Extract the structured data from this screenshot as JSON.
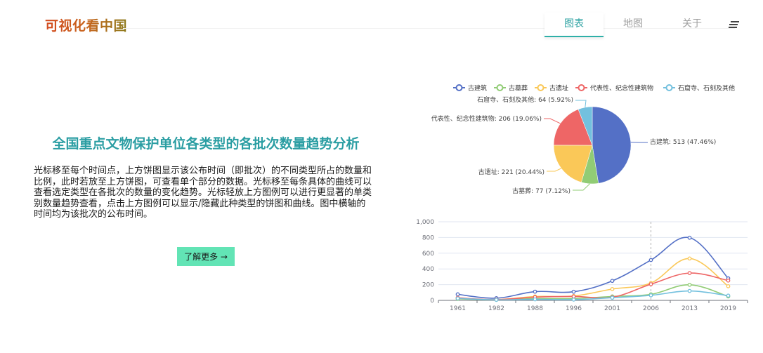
{
  "header": {
    "logo": "可视化看中国",
    "nav": [
      "图表",
      "地图",
      "关于"
    ]
  },
  "intro": {
    "title": "全国重点文物保护单位各类型的各批次数量趋势分析",
    "description": "光标移至每个时间点，上方饼图显示该公布时间（即批次）的不同类型所占的数量和比例，此时若放至上方饼图，可查看单个部分的数据。光标移至每条具体的曲线可以查看选定类型在各批次的数量的变化趋势。光标轻放上方图例可以进行更显著的单类别数量趋势查看，点击上方图例可以显示/隐藏此种类型的饼图和曲线。图中横轴的时间均为该批次的公布时间。",
    "button": "了解更多 →"
  },
  "chart_data": [
    {
      "type": "pie",
      "legend": [
        "古建筑",
        "古墓葬",
        "古遗址",
        "代表性、纪念性建筑物",
        "石窟寺、石刻及其他"
      ],
      "legend_position": "top",
      "slices": [
        {
          "name": "古建筑",
          "value": 513,
          "percent": "47.46%",
          "color": "#5470c6",
          "label": "古建筑: 513 (47.46%)"
        },
        {
          "name": "古墓葬",
          "value": 77,
          "percent": "7.12%",
          "color": "#91cc75",
          "label": "古墓葬: 77 (7.12%)"
        },
        {
          "name": "古遗址",
          "value": 221,
          "percent": "20.44%",
          "color": "#fac858",
          "label": "古遗址: 221 (20.44%)"
        },
        {
          "name": "代表性、纪念性建筑物",
          "value": 206,
          "percent": "19.06%",
          "color": "#ee6666",
          "label": "代表性、纪念性建筑物: 206 (19.06%)"
        },
        {
          "name": "石窟寺、石刻及其他",
          "value": 64,
          "percent": "5.92%",
          "color": "#73c0de",
          "label": "石窟寺、石刻及其他: 64 (5.92%)"
        }
      ]
    },
    {
      "type": "line",
      "x": [
        "1961",
        "1982",
        "1988",
        "1996",
        "2001",
        "2006",
        "2013",
        "2019"
      ],
      "y_ticks": [
        "0",
        "200",
        "400",
        "600",
        "800",
        "1,000"
      ],
      "ylim": [
        0,
        1000
      ],
      "grid": true,
      "highlight_x": "2006",
      "series": [
        {
          "name": "古建筑",
          "color": "#5470c6",
          "values": [
            77,
            28,
            111,
            110,
            248,
            513,
            797,
            280
          ]
        },
        {
          "name": "古墓葬",
          "color": "#91cc75",
          "values": [
            19,
            7,
            22,
            24,
            50,
            77,
            198,
            50
          ]
        },
        {
          "name": "古遗址",
          "color": "#fac858",
          "values": [
            26,
            10,
            49,
            56,
            144,
            221,
            533,
            180
          ]
        },
        {
          "name": "代表性、纪念性建筑物",
          "color": "#ee6666",
          "values": [
            33,
            10,
            41,
            50,
            40,
            206,
            347,
            252
          ]
        },
        {
          "name": "石窟寺、石刻及其他",
          "color": "#73c0de",
          "values": [
            25,
            7,
            13,
            10,
            34,
            64,
            120,
            60
          ]
        }
      ]
    }
  ]
}
